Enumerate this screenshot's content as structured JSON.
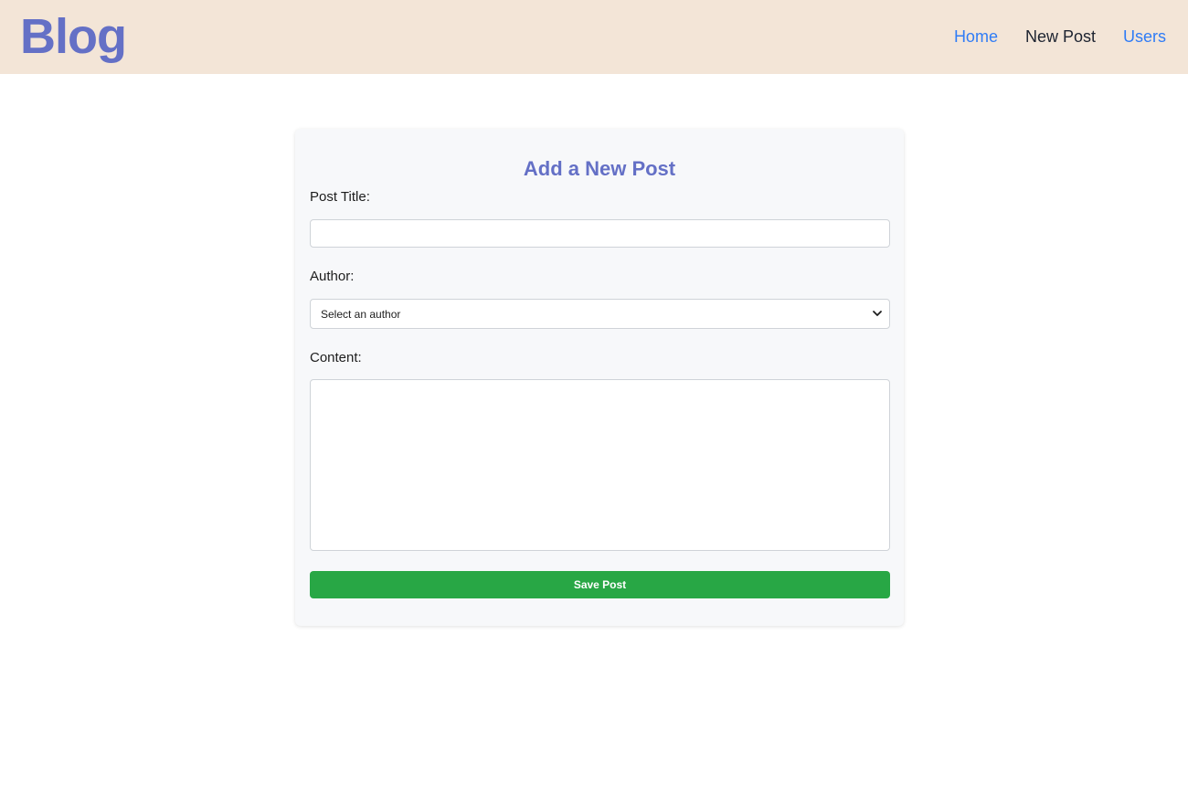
{
  "header": {
    "brand": "Blog",
    "nav": [
      {
        "label": "Home"
      },
      {
        "label": "New Post"
      },
      {
        "label": "Users"
      }
    ]
  },
  "form": {
    "title": "Add a New Post",
    "post_title": {
      "label": "Post Title:",
      "value": ""
    },
    "author": {
      "label": "Author:",
      "selected": "Select an author"
    },
    "content": {
      "label": "Content:",
      "value": ""
    },
    "save_label": "Save Post"
  },
  "colors": {
    "header_bg": "#f3e5d7",
    "brand": "#6470c6",
    "nav_link": "#2f7cf6",
    "nav_active": "#1d2330",
    "save_button": "#28a745"
  }
}
